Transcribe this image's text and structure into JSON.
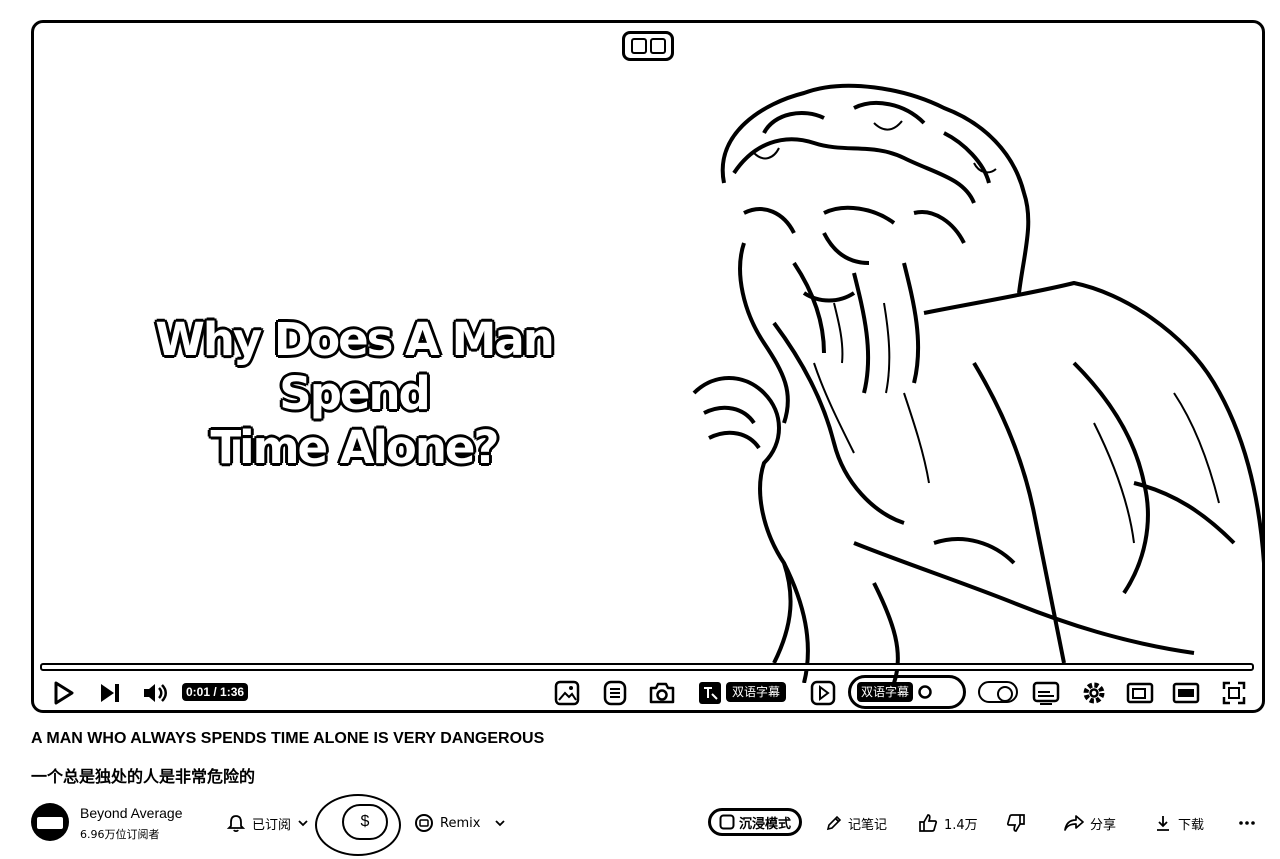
{
  "video": {
    "overlay_title_line1": "Why Does A Man Spend",
    "overlay_title_line2": "Time Alone?",
    "time_display": "0:01 / 1:36",
    "progress": 0.01,
    "subtitle_button_1": "双语字幕",
    "subtitle_button_2": "双语字幕"
  },
  "info": {
    "title_en": "A MAN WHO ALWAYS SPENDS TIME ALONE IS VERY DANGEROUS",
    "title_zh": "一个总是独处的人是非常危险的",
    "channel_name": "Beyond Average",
    "subscriber_count": "6.96万位订阅者",
    "subscribed_label": "已订阅",
    "money_symbol": "$",
    "remix_label": "Remix",
    "immersive_label": "沉浸模式",
    "notes_label": "记笔记",
    "like_count": "1.4万",
    "share_label": "分享",
    "download_label": "下载"
  },
  "icons": {
    "play": "play-icon",
    "next": "next-icon",
    "volume": "volume-icon",
    "settings": "gear-icon",
    "fullscreen": "fullscreen-icon"
  }
}
